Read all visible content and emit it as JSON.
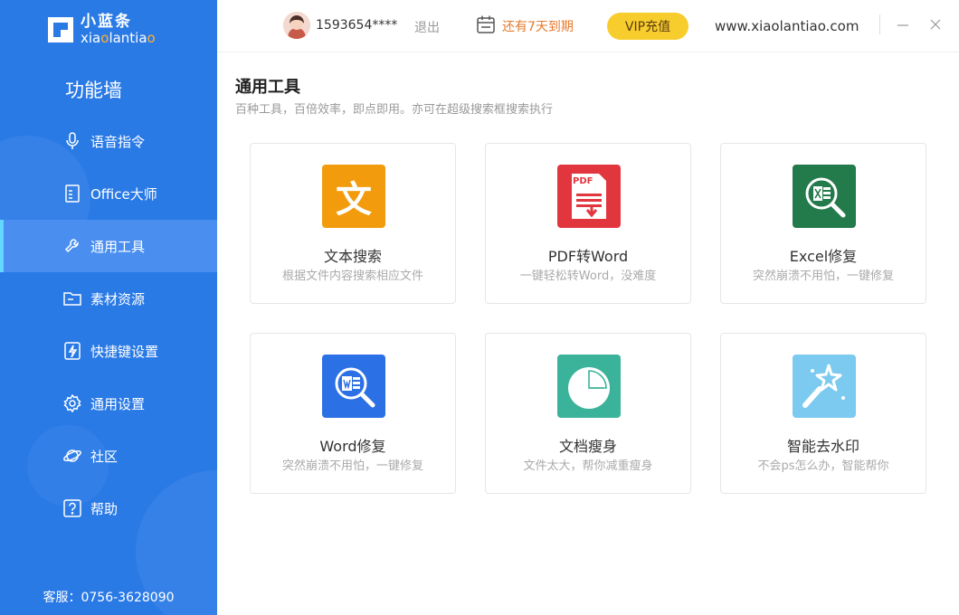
{
  "app": {
    "logo_cn": "小蓝条",
    "logo_en_a": "xia",
    "logo_en_o": "o",
    "logo_en_b": "lantia",
    "logo_en_c": "o"
  },
  "sidebar": {
    "title": "功能墙",
    "items": [
      {
        "label": "语音指令",
        "icon": "microphone-icon"
      },
      {
        "label": "Office大师",
        "icon": "document-icon"
      },
      {
        "label": "通用工具",
        "icon": "wrench-icon",
        "active": true
      },
      {
        "label": "素材资源",
        "icon": "folder-icon"
      },
      {
        "label": "快捷键设置",
        "icon": "lightning-icon"
      },
      {
        "label": "通用设置",
        "icon": "gear-icon"
      },
      {
        "label": "社区",
        "icon": "planet-icon"
      },
      {
        "label": "帮助",
        "icon": "question-icon"
      }
    ],
    "hotline": "客服：0756-3628090"
  },
  "header": {
    "phone": "1593654****",
    "logout": "退出",
    "expire": "还有7天到期",
    "vip": "VIP充值",
    "site": "www.xiaolantiao.com"
  },
  "main": {
    "title": "通用工具",
    "subtitle": "百种工具，百倍效率，即点即用。亦可在超级搜索框搜索执行",
    "tools": [
      {
        "title": "文本搜索",
        "desc": "根据文件内容搜索相应文件",
        "icon": "text-search-icon",
        "color": "#f29b0c"
      },
      {
        "title": "PDF转Word",
        "desc": "一键轻松转Word，没难度",
        "icon": "pdf-to-word-icon",
        "color": "#e2363f"
      },
      {
        "title": "Excel修复",
        "desc": "突然崩溃不用怕，一键修复",
        "icon": "excel-repair-icon",
        "color": "#237a4b"
      },
      {
        "title": "Word修复",
        "desc": "突然崩溃不用怕，一键修复",
        "icon": "word-repair-icon",
        "color": "#2b70e4"
      },
      {
        "title": "文档瘦身",
        "desc": "文件太大，帮你减重瘦身",
        "icon": "doc-slim-icon",
        "color": "#3ab39a"
      },
      {
        "title": "智能去水印",
        "desc": "不会ps怎么办，智能帮你",
        "icon": "magic-wand-icon",
        "color": "#7ccaf0"
      }
    ],
    "pdf_badge": "PDF",
    "text_glyph": "文"
  }
}
